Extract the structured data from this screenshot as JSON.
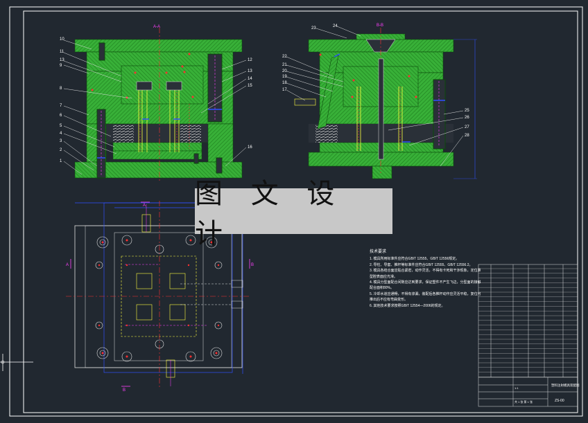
{
  "overlay_title": "图 文 设 计",
  "section_labels": {
    "left_view": "A-A",
    "right_view": "B-B",
    "plan_cut_a": "A",
    "plan_cut_b": "B",
    "plan_cut_a2": "A",
    "plan_cut_b2": "B"
  },
  "left_callouts": [
    "10",
    "11",
    "13",
    "9",
    "8",
    "7",
    "6",
    "5",
    "4",
    "3",
    "2",
    "1"
  ],
  "left_right_callouts": [
    "12",
    "13",
    "14",
    "15",
    "16"
  ],
  "right_callouts_left": [
    "22",
    "21",
    "20",
    "19",
    "18",
    "17"
  ],
  "right_callouts_top": [
    "23",
    "24"
  ],
  "right_callouts_right": [
    "25",
    "26",
    "27",
    "28"
  ],
  "notes": {
    "title": "技术要求",
    "lines": [
      "1. 模具所用标准件应符合GB/T 12555、GB/T 12556规定。",
      "2. 导柱、导套、推杆等标准件应符合GB/T 12555、GB/T 12556.2。",
      "3. 模具各结合面应贴合紧密，动作灵活，不得有卡死和干涉现象，定位准确。",
      "   型腔表面应光滑。",
      "4. 模具分型面配合间隙应达到要求，保证塑件不产生飞边，分型面的接触面积不小于",
      "   配合面积80%。",
      "5. 冷却水道应通畅，不得有渗漏，装配后各推杆动作应灵活平稳，复位可靠，",
      "   推出后不应有弯曲变形。",
      "6. 其他技术要求按照GB/T 12554—2006的规定。"
    ]
  },
  "title_block": {
    "drawing_name": "塑料注射模具装配图",
    "scale": "1:1",
    "sheet": "共 1 张 第 1 张",
    "number": "ZS-00"
  },
  "colors": {
    "background": "#212830",
    "frame": "#ffffff",
    "plate_green": "#33a833",
    "hatch_dark": "#1e7e1e",
    "cad_blue": "#3050ff",
    "cad_magenta": "#ff40ff",
    "cad_red": "#ff3030",
    "cad_yellow": "#ffff40",
    "overlay": "#c8c8c8"
  }
}
